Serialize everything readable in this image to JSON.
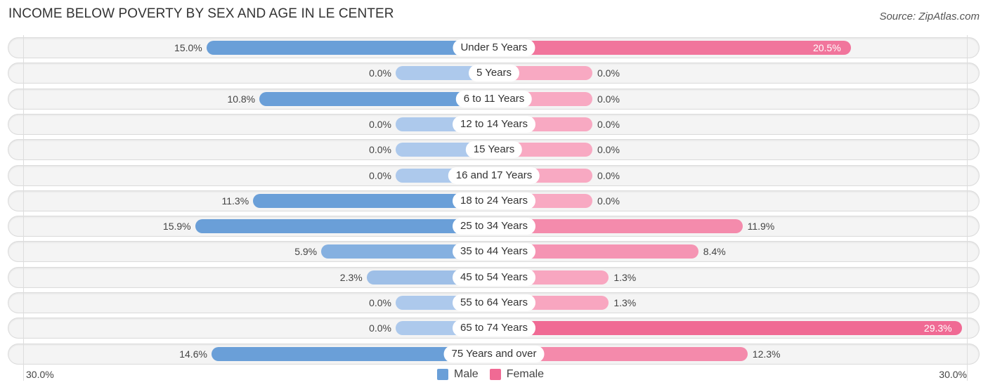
{
  "title": "INCOME BELOW POVERTY BY SEX AND AGE IN LE CENTER",
  "source": "Source: ZipAtlas.com",
  "axis": {
    "left_label": "30.0%",
    "right_label": "30.0%"
  },
  "legend": [
    {
      "name": "Male",
      "color": "#6a9fd8"
    },
    {
      "name": "Female",
      "color": "#f06a94"
    }
  ],
  "chart_data": {
    "type": "bar",
    "title": "INCOME BELOW POVERTY BY SEX AND AGE IN LE CENTER",
    "orientation": "horizontal-diverging",
    "xlim": [
      0,
      30
    ],
    "categories": [
      "Under 5 Years",
      "5 Years",
      "6 to 11 Years",
      "12 to 14 Years",
      "15 Years",
      "16 and 17 Years",
      "18 to 24 Years",
      "25 to 34 Years",
      "35 to 44 Years",
      "45 to 54 Years",
      "55 to 64 Years",
      "65 to 74 Years",
      "75 Years and over"
    ],
    "series": [
      {
        "name": "Male",
        "values": [
          15.0,
          0.0,
          10.8,
          0.0,
          0.0,
          0.0,
          11.3,
          15.9,
          5.9,
          2.3,
          0.0,
          0.0,
          14.6
        ],
        "labels": [
          "15.0%",
          "0.0%",
          "10.8%",
          "0.0%",
          "0.0%",
          "0.0%",
          "11.3%",
          "15.9%",
          "5.9%",
          "2.3%",
          "0.0%",
          "0.0%",
          "14.6%"
        ]
      },
      {
        "name": "Female",
        "values": [
          20.5,
          0.0,
          0.0,
          0.0,
          0.0,
          0.0,
          0.0,
          11.9,
          8.4,
          1.3,
          1.3,
          29.3,
          12.3
        ],
        "labels": [
          "20.5%",
          "0.0%",
          "0.0%",
          "0.0%",
          "0.0%",
          "0.0%",
          "0.0%",
          "11.9%",
          "8.4%",
          "1.3%",
          "1.3%",
          "29.3%",
          "12.3%"
        ]
      }
    ],
    "legend_position": "bottom-center"
  }
}
